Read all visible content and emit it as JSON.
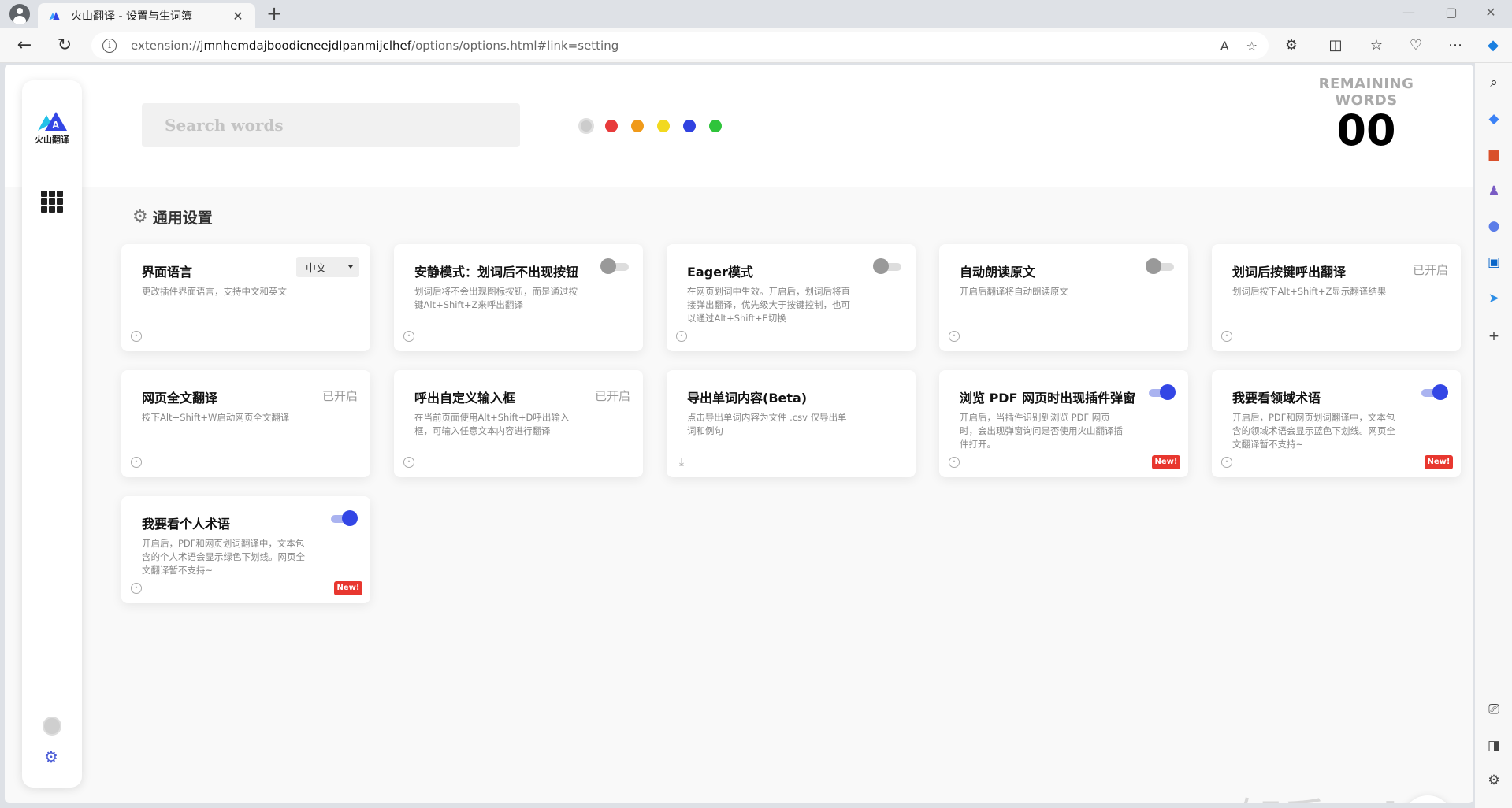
{
  "browser": {
    "tab_title": "火山翻译 - 设置与生词簿",
    "tab_close": "✕",
    "new_tab": "+",
    "url_prefix": "extension://",
    "url_host": "jmnhemdajboodicneejdlpanmijclhef",
    "url_path": "/options/options.html#link=setting",
    "window_controls": [
      "—",
      "▢",
      "✕"
    ]
  },
  "sidebar": {
    "logo_text": "火山翻译"
  },
  "header": {
    "search_placeholder": "Search words",
    "color_dots": [
      "#cccccc",
      "#e83b3b",
      "#f09a1a",
      "#f2d91f",
      "#3042e0",
      "#2fc43b"
    ],
    "remaining_label": "REMAINING WORDS",
    "remaining_count": "00"
  },
  "section": {
    "title": "通用设置"
  },
  "cards": [
    {
      "title": "界面语言",
      "desc": "更改插件界面语言，支持中文和英文",
      "control": "select",
      "value": "中文"
    },
    {
      "title": "安静模式：划词后不出现按钮",
      "desc": "划词后将不会出现图标按钮，而是通过按键Alt+Shift+Z来呼出翻译",
      "control": "toggle",
      "on": false
    },
    {
      "title": "Eager模式",
      "desc": "在网页划词中生效。开启后，划词后将直接弹出翻译，优先级大于按键控制，也可以通过Alt+Shift+E切换",
      "control": "toggle",
      "on": false
    },
    {
      "title": "自动朗读原文",
      "desc": "开启后翻译将自动朗读原文",
      "control": "toggle",
      "on": false
    },
    {
      "title": "划词后按键呼出翻译",
      "desc": "划词后按下Alt+Shift+Z显示翻译结果",
      "control": "status",
      "value": "已开启"
    },
    {
      "title": "网页全文翻译",
      "desc": "按下Alt+Shift+W启动网页全文翻译",
      "control": "status",
      "value": "已开启"
    },
    {
      "title": "呼出自定义输入框",
      "desc": "在当前页面使用Alt+Shift+D呼出输入框，可输入任意文本内容进行翻译",
      "control": "status",
      "value": "已开启"
    },
    {
      "title": "导出单词内容(Beta)",
      "desc": "点击导出单词内容为文件 .csv 仅导出单词和例句",
      "control": "none"
    },
    {
      "title": "浏览 PDF 网页时出现插件弹窗",
      "desc": "开启后，当插件识别到浏览 PDF 网页时，会出现弹窗询问是否使用火山翻译插件打开。",
      "control": "toggle",
      "on": true,
      "badge": "New!"
    },
    {
      "title": "我要看领域术语",
      "desc": "开启后，PDF和网页划词翻译中，文本包含的领域术语会显示蓝色下划线。网页全文翻译暂不支持~",
      "control": "toggle",
      "on": true,
      "badge": "New!"
    },
    {
      "title": "我要看个人术语",
      "desc": "开启后，PDF和网页划词翻译中，文本包含的个人术语会显示绿色下划线。网页全文翻译暂不支持~",
      "control": "toggle",
      "on": true,
      "badge": "New!"
    }
  ],
  "watermark": "知乎 @laoe"
}
